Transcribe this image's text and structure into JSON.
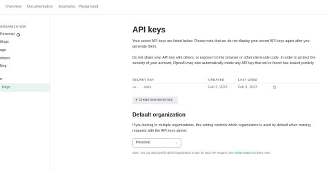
{
  "topnav": {
    "items": [
      "Overview",
      "Documentation",
      "Examples",
      "Playground"
    ]
  },
  "sidebar": {
    "org_section": "ORGANIZATION",
    "org_items": [
      "Personal",
      "ttings",
      "age",
      "mbers",
      "lling"
    ],
    "user_section": "R",
    "user_items": [
      "Keys"
    ],
    "active_item": "Keys"
  },
  "page": {
    "title": "API keys",
    "intro": "Your secret API keys are listed below. Please note that we do not display your secret API keys again after you generate them.",
    "warning": "Do not share your API key with others, or expose it in the browser or other client-side code. In order to protect the security of your account, OpenAI may also automatically rotate any API key that we've found has leaked publicly."
  },
  "keys_table": {
    "headers": [
      "SECRET KEY",
      "CREATED",
      "LAST USED"
    ],
    "rows": [
      {
        "key": "sk-...X841",
        "created": "Feb 3, 2023",
        "last_used": "Feb 9, 2023"
      }
    ]
  },
  "create_button": {
    "label": "Create new secret key",
    "icon": "plus-icon"
  },
  "default_org": {
    "title": "Default organization",
    "description": "If you belong to multiple organizations, this setting controls which organization is used by default when making requests with the API keys above.",
    "selected": "Personal",
    "note_prefix": "Note: You can also specify which organization to use for each API request. See ",
    "note_link": "Authentication",
    "note_suffix": " to learn more."
  },
  "colors": {
    "accent": "#10a37f",
    "active_bg": "#e9f3ef",
    "active_text": "#0e7a5c",
    "muted": "#6e6e80",
    "border": "#ececf1"
  }
}
